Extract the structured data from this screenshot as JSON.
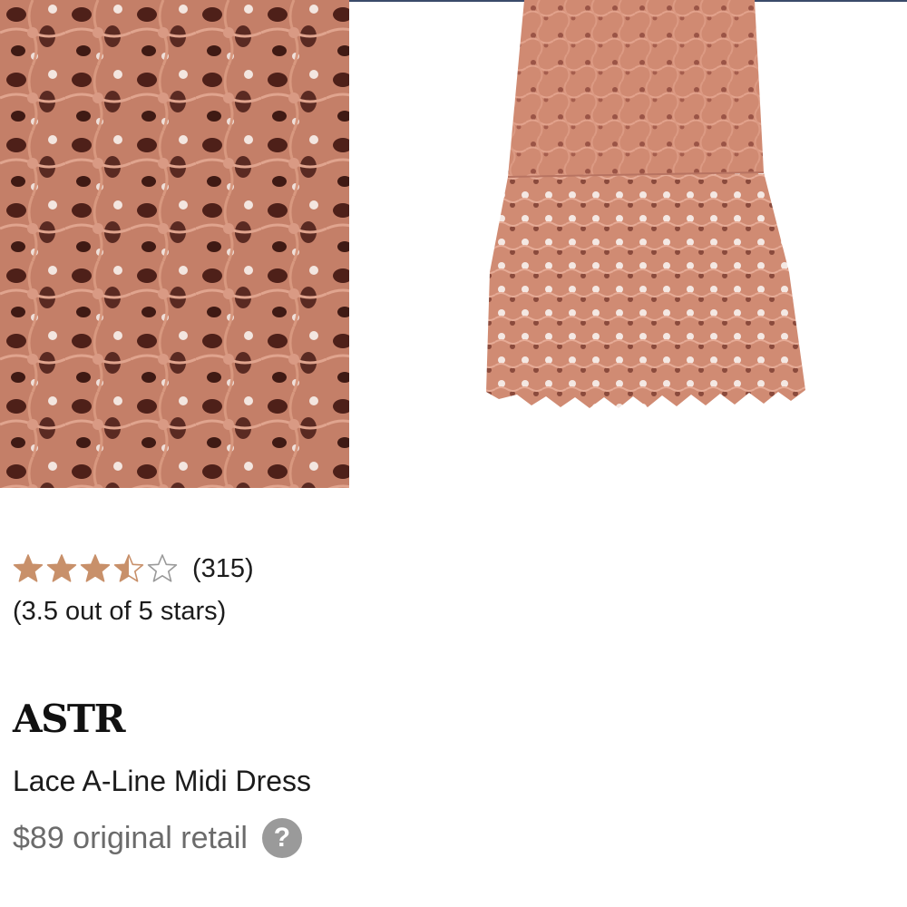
{
  "gallery": {
    "images": [
      {
        "name": "lace-detail-photo"
      },
      {
        "name": "dress-front-photo"
      }
    ]
  },
  "rating": {
    "value": 3.5,
    "max": 5,
    "count_label": "(315)",
    "summary": "(3.5 out of 5 stars)",
    "star_color": "#c8906a",
    "empty_star_color": "#9a9a9a"
  },
  "product": {
    "brand": "ASTR",
    "name": "Lace A-Line Midi Dress",
    "price": "$89 original retail",
    "help_icon_label": "?"
  },
  "colors": {
    "lace": "#c17d66",
    "lace_dark": "#5a2a22",
    "lace_light": "#d79a85",
    "text_primary": "#1c1c1c",
    "text_secondary": "#6b6b6b"
  }
}
